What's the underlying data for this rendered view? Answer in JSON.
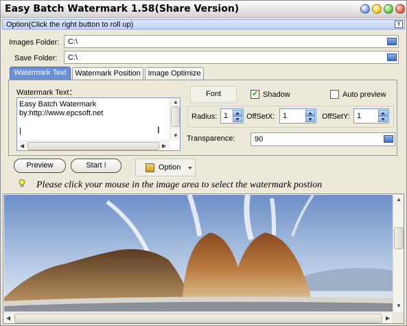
{
  "window": {
    "title": "Easy Batch Watermark 1.58(Share Version)"
  },
  "option_bar": {
    "label": "Option(Click the right button to roll up)",
    "roll_symbol": "⇑"
  },
  "images_folder": {
    "label": "Images Folder:",
    "value": "C:\\"
  },
  "save_folder": {
    "label": "Save Folder:",
    "value": "C:\\"
  },
  "tabs": [
    {
      "label": "Watermark Text",
      "active": true
    },
    {
      "label": "Watermark Position",
      "active": false
    },
    {
      "label": "Image Optimize",
      "active": false
    }
  ],
  "watermark_text": {
    "label": "Watermark Text：",
    "lines": [
      "Easy Batch Watermark",
      "by:http://www.epcsoft.net",
      "|"
    ]
  },
  "font_button": "Font",
  "shadow": {
    "label": "Shadow",
    "checked": true
  },
  "auto_preview": {
    "label": "Auto preview",
    "checked": false
  },
  "radius": {
    "label": "Radius:",
    "value": "1"
  },
  "offset_x": {
    "label": "OffSetX:",
    "value": "1"
  },
  "offset_y": {
    "label": "OffSetY:",
    "value": "1"
  },
  "transparence": {
    "label": "Transparence:",
    "value": "90"
  },
  "buttons": {
    "preview": "Preview",
    "start": "Start !",
    "option": "Option"
  },
  "hint": "Please click your mouse in the image area to select the watermark postion",
  "colors": {
    "accent": "#6a8fd6",
    "title_bg": "#e4e4e4",
    "panel": "#ece9d8"
  }
}
